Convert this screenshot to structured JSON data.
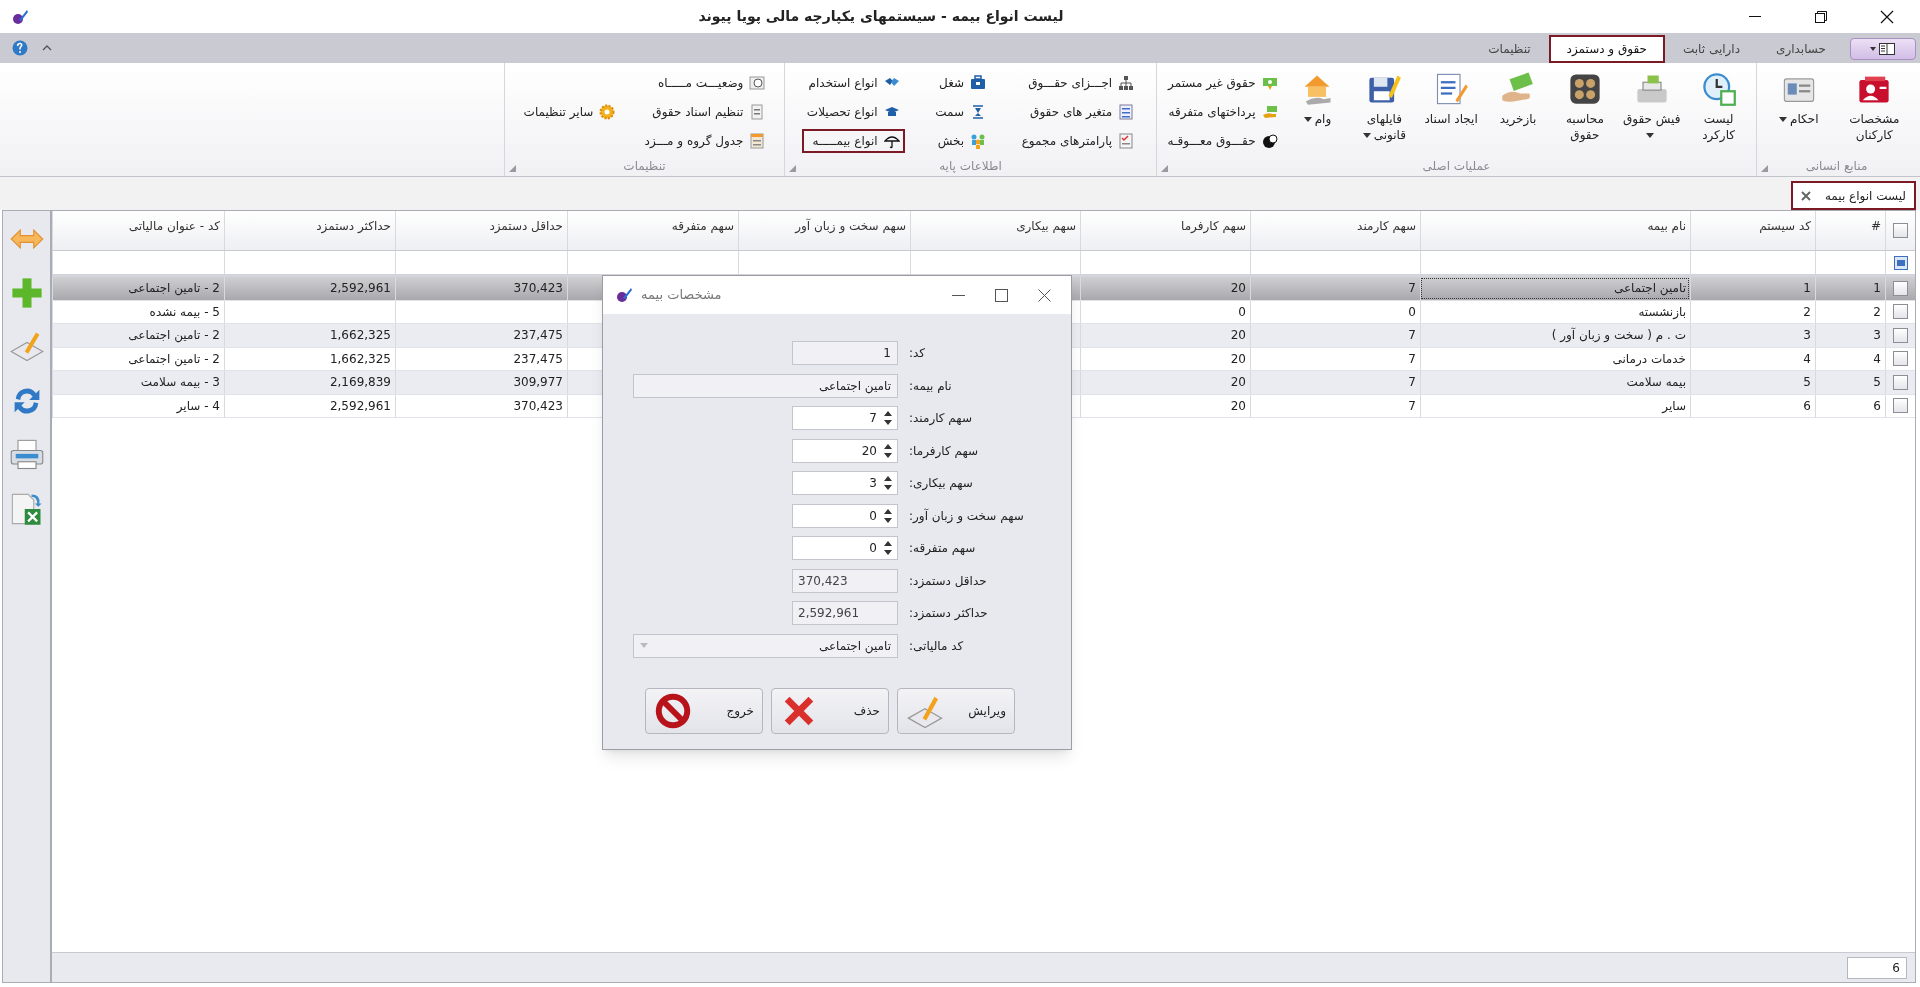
{
  "window": {
    "title": "لیست انواع بیمه - سیستمهای یکپارچه مالی پویا پیوند"
  },
  "ribbon_tabs": [
    {
      "label": "حسابداری",
      "selected": false,
      "highlighted": false
    },
    {
      "label": "دارایی ثابت",
      "selected": false,
      "highlighted": false
    },
    {
      "label": "حقوق و دستمزد",
      "selected": true,
      "highlighted": true
    },
    {
      "label": "تنظیمات",
      "selected": false,
      "highlighted": false
    }
  ],
  "ribbon_groups": [
    {
      "label": "منابع انسانی",
      "columns": [
        {
          "kind": "large",
          "items": [
            {
              "label": "مشخصات کارکنان",
              "dropdown": false,
              "highlighted": false
            }
          ]
        },
        {
          "kind": "large",
          "items": [
            {
              "label": "احکام",
              "dropdown": true,
              "highlighted": false
            }
          ]
        }
      ]
    },
    {
      "label": "عملیات اصلی",
      "columns": [
        {
          "kind": "large",
          "items": [
            {
              "label": "لیست کارکرد",
              "dropdown": false,
              "highlighted": false
            }
          ]
        },
        {
          "kind": "large",
          "items": [
            {
              "label": "فیش حقوق",
              "dropdown": true,
              "highlighted": false
            }
          ]
        },
        {
          "kind": "large",
          "items": [
            {
              "label": "محاسبه حقوق",
              "dropdown": false,
              "highlighted": false
            }
          ]
        },
        {
          "kind": "large",
          "items": [
            {
              "label": "بازخرید",
              "dropdown": false,
              "highlighted": false
            }
          ]
        },
        {
          "kind": "large",
          "items": [
            {
              "label": "ایجاد اسناد",
              "dropdown": false,
              "highlighted": false
            }
          ]
        },
        {
          "kind": "large",
          "items": [
            {
              "label": "فایلهای قانونی",
              "dropdown": true,
              "highlighted": false
            }
          ]
        },
        {
          "kind": "large",
          "items": [
            {
              "label": "وام",
              "dropdown": true,
              "highlighted": false
            }
          ]
        },
        {
          "kind": "small",
          "items": [
            {
              "label": "حقوق غیر مستمر",
              "dropdown": false,
              "highlighted": false
            },
            {
              "label": "پرداختهای متفرقه",
              "dropdown": false,
              "highlighted": false
            },
            {
              "label": "حقـــوق معـــوقـه",
              "dropdown": false,
              "highlighted": false
            }
          ]
        }
      ]
    },
    {
      "label": "اطلاعات پایه",
      "columns": [
        {
          "kind": "small",
          "items": [
            {
              "label": "اجـــزای حقـــوق",
              "dropdown": false,
              "highlighted": false
            },
            {
              "label": "متغیر های حقوق",
              "dropdown": false,
              "highlighted": false
            },
            {
              "label": "پارامترهای مجموع",
              "dropdown": false,
              "highlighted": false
            }
          ]
        },
        {
          "kind": "small",
          "items": [
            {
              "label": "شغل",
              "dropdown": false,
              "highlighted": false
            },
            {
              "label": "سمت",
              "dropdown": false,
              "highlighted": false
            },
            {
              "label": "بخش",
              "dropdown": false,
              "highlighted": false
            }
          ]
        },
        {
          "kind": "small",
          "items": [
            {
              "label": "انواع استخدام",
              "dropdown": false,
              "highlighted": false
            },
            {
              "label": "انواع تحصیلات",
              "dropdown": false,
              "highlighted": false
            },
            {
              "label": "انواع بیمـــــه",
              "dropdown": false,
              "highlighted": true
            }
          ]
        }
      ]
    },
    {
      "label": "تنظیمات",
      "columns": [
        {
          "kind": "small",
          "items": [
            {
              "label": "وضعیـــت مـــــاه",
              "dropdown": false,
              "highlighted": false
            },
            {
              "label": "تنظیم اسناد حقوق",
              "dropdown": false,
              "highlighted": false
            },
            {
              "label": "جدول گروه و مـــزد",
              "dropdown": false,
              "highlighted": false
            }
          ]
        },
        {
          "kind": "small",
          "items": [
            {
              "label": "سایر تنظیمات",
              "dropdown": false,
              "highlighted": false
            }
          ]
        }
      ]
    }
  ],
  "document_tab": {
    "label": "لیست انواع بیمه",
    "highlighted": true
  },
  "table": {
    "columns": [
      "#",
      "کد سیستم",
      "نام بیمه",
      "سهم کارمند",
      "سهم کارفرما",
      "سهم بیکاری",
      "سهم سخت و زبان آور",
      "سهم متفرقه",
      "حداقل دستمزد",
      "حداکثر دستمزد",
      "کد - عنوان مالیاتی"
    ],
    "rows": [
      {
        "selected": true,
        "checked": false,
        "row_number": "1",
        "system_code": "1",
        "insurance_name": "تامین اجتماعی",
        "employee_share": "7",
        "employer_share": "20",
        "min_wage": "370,423",
        "max_wage": "2,592,961",
        "tax_code_title": "2 - تامین اجتماعی"
      },
      {
        "selected": false,
        "checked": false,
        "row_number": "2",
        "system_code": "2",
        "insurance_name": "بازنشسته",
        "employee_share": "0",
        "employer_share": "0",
        "tax_code_title": "5 - بیمه نشده"
      },
      {
        "selected": false,
        "checked": false,
        "row_number": "3",
        "system_code": "3",
        "insurance_name": "ت . م ( سخت و زبان آور )",
        "employee_share": "7",
        "employer_share": "20",
        "min_wage": "237,475",
        "max_wage": "1,662,325",
        "tax_code_title": "2 - تامین اجتماعی"
      },
      {
        "selected": false,
        "checked": false,
        "row_number": "4",
        "system_code": "4",
        "insurance_name": "خدمات درمانی",
        "employee_share": "7",
        "employer_share": "20",
        "min_wage": "237,475",
        "max_wage": "1,662,325",
        "tax_code_title": "2 - تامین اجتماعی"
      },
      {
        "selected": false,
        "checked": false,
        "row_number": "5",
        "system_code": "5",
        "insurance_name": "بیمه سلامت",
        "employee_share": "7",
        "employer_share": "20",
        "min_wage": "309,977",
        "max_wage": "2,169,839",
        "tax_code_title": "3 - بیمه سلامت"
      },
      {
        "selected": false,
        "checked": false,
        "row_number": "6",
        "system_code": "6",
        "insurance_name": "سایر",
        "employee_share": "7",
        "employer_share": "20",
        "min_wage": "370,423",
        "max_wage": "2,592,961",
        "tax_code_title": "4 - سایر"
      }
    ],
    "record_count": "6",
    "select_all_checked": false
  },
  "dialog": {
    "title": "مشخصات بیمه",
    "fields": [
      {
        "label": "کد:",
        "value": "1",
        "kind": "readonly"
      },
      {
        "label": "نام بیمه:",
        "value": "تامین اجتماعی",
        "kind": "readonly_wide"
      },
      {
        "label": "سهم کارمند:",
        "value": "7",
        "kind": "spinner"
      },
      {
        "label": "سهم کارفرما:",
        "value": "20",
        "kind": "spinner"
      },
      {
        "label": "سهم بیکاری:",
        "value": "3",
        "kind": "spinner"
      },
      {
        "label": "سهم سخت و زبان آور:",
        "value": "0",
        "kind": "spinner"
      },
      {
        "label": "سهم متفرقه:",
        "value": "0",
        "kind": "spinner"
      },
      {
        "label": "حداقل دستمزد:",
        "value": "370,423",
        "kind": "number"
      },
      {
        "label": "حداکثر دستمزد:",
        "value": "2,592,961",
        "kind": "number"
      },
      {
        "label": "کد مالیاتی:",
        "value": "تامین اجتماعی",
        "kind": "dropdown"
      }
    ],
    "buttons": [
      {
        "label": "ویرایش",
        "kind": "edit"
      },
      {
        "label": "حذف",
        "kind": "delete"
      },
      {
        "label": "خروج",
        "kind": "exit"
      }
    ]
  }
}
